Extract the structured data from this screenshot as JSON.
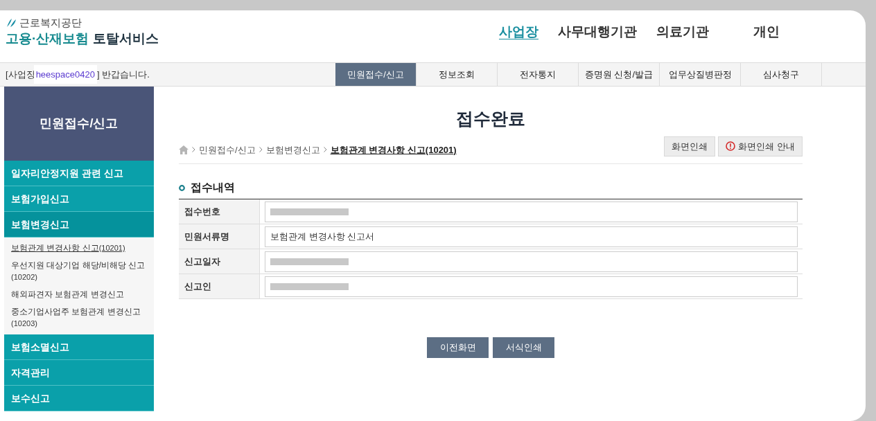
{
  "logo": {
    "org": "근로복지공단",
    "service_colored": "고용·산재보험",
    "service_rest": "토탈서비스"
  },
  "top_nav": [
    {
      "label": "사업장",
      "selected": true
    },
    {
      "label": "사무대행기관",
      "selected": false
    },
    {
      "label": "의료기관",
      "selected": false
    },
    {
      "label": "개인",
      "selected": false
    }
  ],
  "welcome": {
    "prefix": "[사업장",
    "user": "heespace0420",
    "suffix": "] 반갑습니다."
  },
  "menu_tabs": [
    {
      "label": "민원접수/신고",
      "selected": true
    },
    {
      "label": "정보조회",
      "selected": false
    },
    {
      "label": "전자통지",
      "selected": false
    },
    {
      "label": "증명원 신청/발급",
      "selected": false
    },
    {
      "label": "업무상질병판정",
      "selected": false
    },
    {
      "label": "심사청구",
      "selected": false
    }
  ],
  "sidebar": {
    "title": "민원접수/신고",
    "items": [
      {
        "label": "일자리안정지원 관련 신고",
        "expanded": false
      },
      {
        "label": "보험가입신고",
        "expanded": false
      },
      {
        "label": "보험변경신고",
        "expanded": true,
        "children": [
          {
            "label": "보험관계 변경사항 신고",
            "code": "(10201)",
            "selected": true
          },
          {
            "label": "우선지원 대상기업 해당/비해당 신고",
            "code": "(10202)",
            "selected": false
          },
          {
            "label": "해외파견자 보험관계 변경신고",
            "selected": false
          },
          {
            "label": "중소기업사업주 보험관계 변경신고",
            "code": "(10203)",
            "selected": false
          }
        ]
      },
      {
        "label": "보험소멸신고",
        "expanded": false
      },
      {
        "label": "자격관리",
        "expanded": false
      },
      {
        "label": "보수신고",
        "expanded": false
      }
    ]
  },
  "page_title": "접수완료",
  "breadcrumb": [
    "민원접수/신고",
    "보험변경신고",
    "보험관계 변경사항 신고(10201)"
  ],
  "print_buttons": [
    {
      "label": "화면인쇄",
      "kind": "plain"
    },
    {
      "label": "화면인쇄 안내",
      "kind": "info"
    }
  ],
  "section_title": "접수내역",
  "fields": [
    {
      "label": "접수번호",
      "redacted": true
    },
    {
      "label": "민원서류명",
      "value": "보험관계 변경사항 신고서",
      "redacted": false
    },
    {
      "label": "신고일자",
      "redacted": true
    },
    {
      "label": "신고인",
      "redacted": true
    }
  ],
  "bottom_buttons": [
    "이전화면",
    "서식인쇄"
  ]
}
